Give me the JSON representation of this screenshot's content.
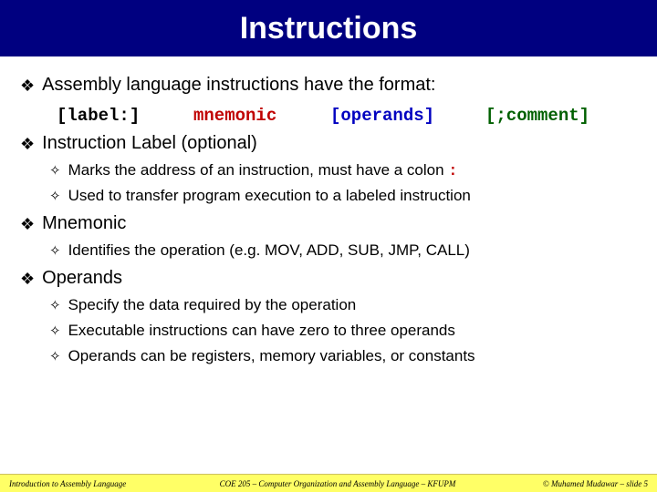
{
  "title": "Instructions",
  "bullets": {
    "b1": "Assembly language instructions have the format:",
    "format": {
      "label": "[label:]",
      "mnemonic": "mnemonic",
      "operands": "[operands]",
      "comment": "[;comment]"
    },
    "b2": "Instruction Label (optional)",
    "b2_1a": "Marks the address of an instruction, must have a colon ",
    "b2_1b": ":",
    "b2_2": "Used to transfer program execution to a labeled instruction",
    "b3": "Mnemonic",
    "b3_1": "Identifies the operation (e.g. MOV, ADD, SUB, JMP, CALL)",
    "b4": "Operands",
    "b4_1": "Specify the data required by the operation",
    "b4_2": "Executable instructions can have zero to three operands",
    "b4_3": "Operands can be registers, memory variables, or constants"
  },
  "footer": {
    "left": "Introduction to Assembly Language",
    "center": "COE 205 – Computer Organization and Assembly Language – KFUPM",
    "right": "© Muhamed Mudawar – slide 5"
  }
}
